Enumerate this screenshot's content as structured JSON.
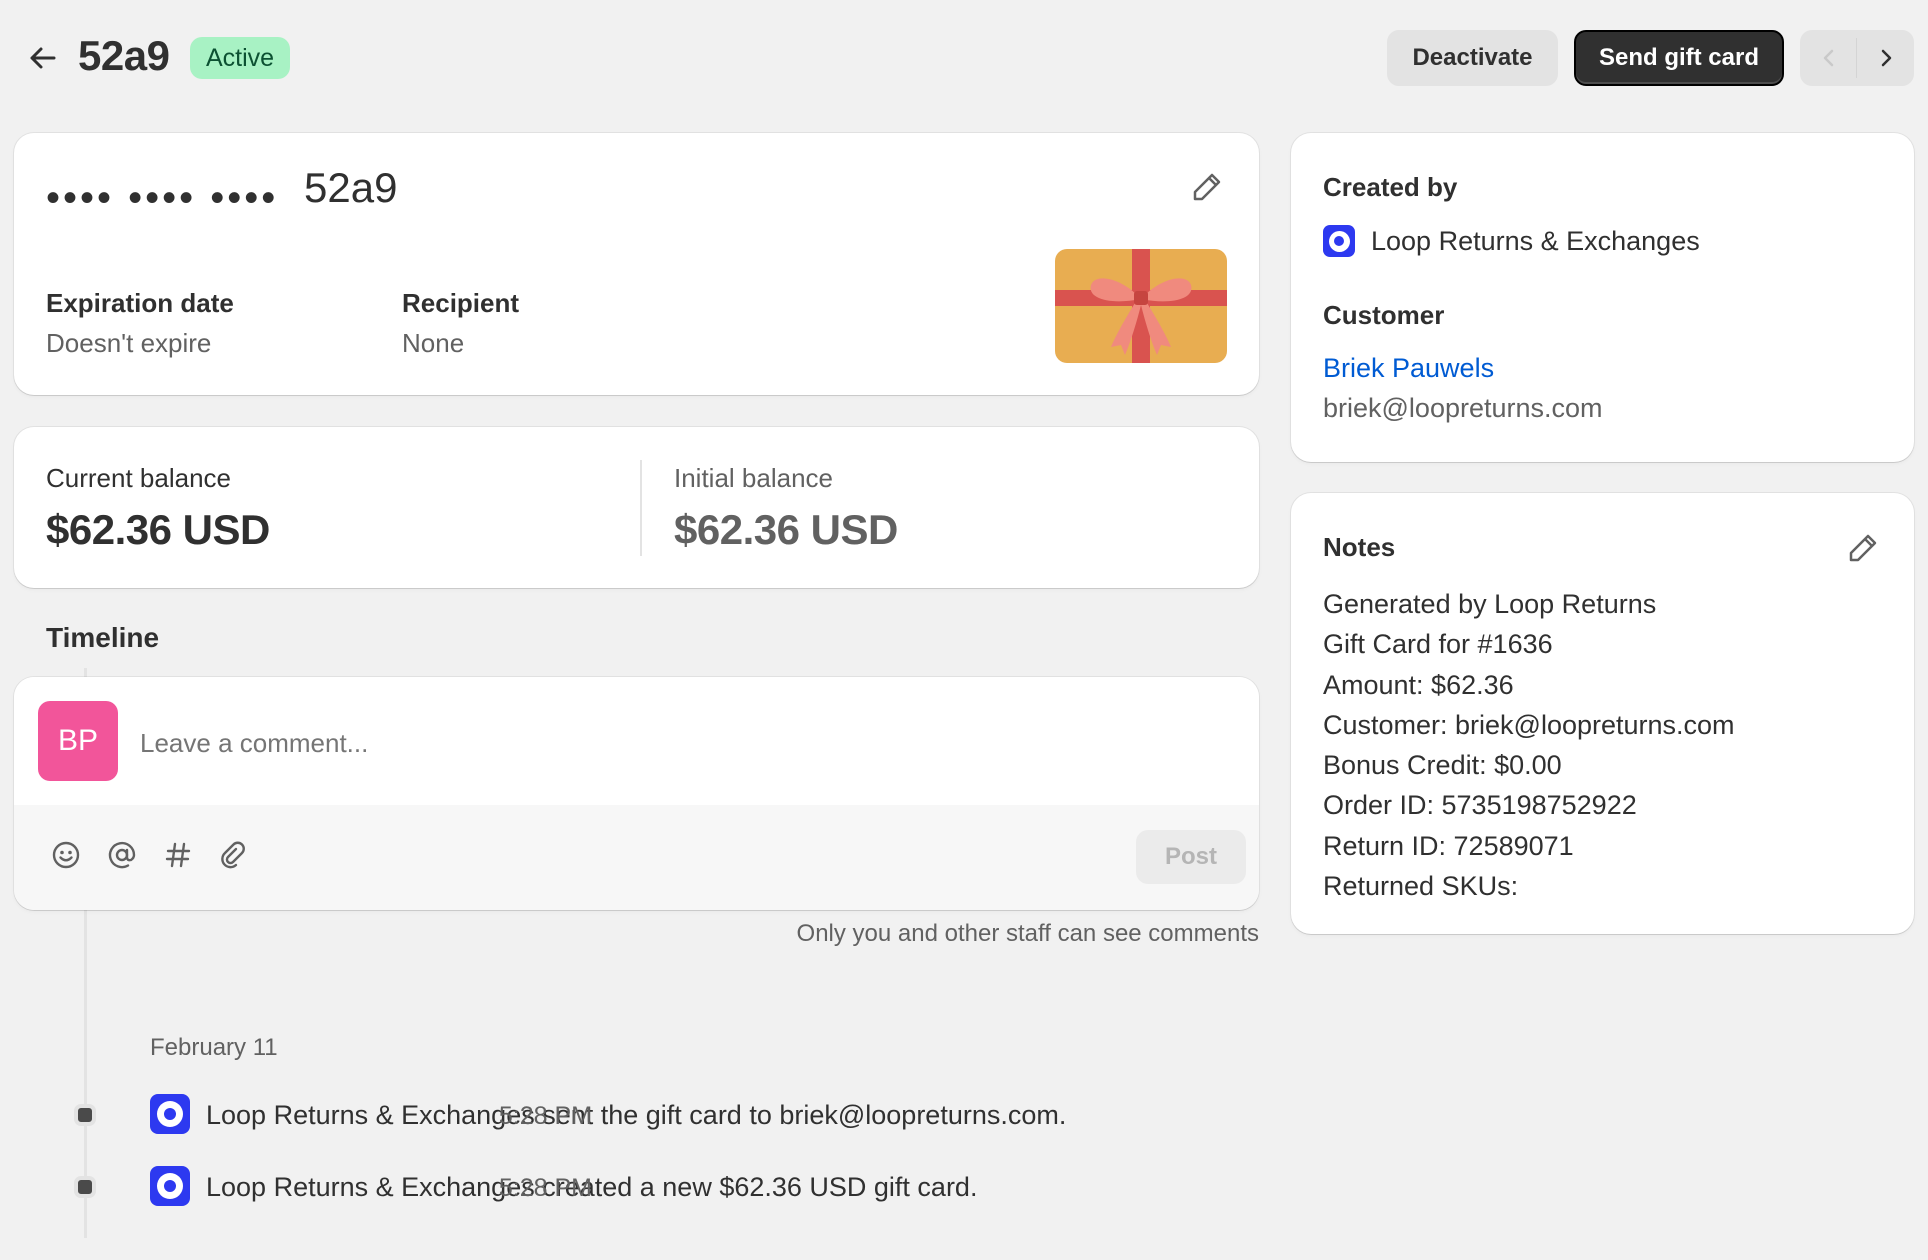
{
  "header": {
    "title": "52a9",
    "status": "Active",
    "deactivate_label": "Deactivate",
    "send_label": "Send gift card"
  },
  "gift_card": {
    "masked_code": "•••• •••• ••••",
    "last4": "52a9",
    "expiration_label": "Expiration date",
    "expiration_value": "Doesn't expire",
    "recipient_label": "Recipient",
    "recipient_value": "None"
  },
  "balance": {
    "current_label": "Current balance",
    "current_value": "$62.36 USD",
    "initial_label": "Initial balance",
    "initial_value": "$62.36 USD"
  },
  "timeline": {
    "title": "Timeline",
    "avatar_initials": "BP",
    "comment_placeholder": "Leave a comment...",
    "post_label": "Post",
    "staff_note": "Only you and other staff can see comments",
    "date_header": "February 11",
    "events": [
      {
        "text": "Loop Returns & Exchanges sent the gift card to briek@loopreturns.com.",
        "time": "5:28 PM"
      },
      {
        "text": "Loop Returns & Exchanges created a new $62.36 USD gift card.",
        "time": "5:28 PM"
      }
    ]
  },
  "sidebar": {
    "created_by_heading": "Created by",
    "creator": "Loop Returns & Exchanges",
    "customer_heading": "Customer",
    "customer_name": "Briek Pauwels",
    "customer_email": "briek@loopreturns.com",
    "notes_heading": "Notes",
    "notes": [
      "Generated by Loop Returns",
      "Gift Card for #1636",
      "Amount: $62.36",
      "Customer: briek@loopreturns.com",
      "Bonus Credit: $0.00",
      "Order ID: 5735198752922",
      "Return ID: 72589071",
      "Returned SKUs:"
    ]
  },
  "icons": {
    "back": "arrow-left-icon",
    "prev": "chevron-left-icon",
    "next": "chevron-right-icon",
    "edit": "pencil-icon",
    "emoji": "smiley-icon",
    "mention": "at-sign-icon",
    "hashtag": "hashtag-icon",
    "attach": "paperclip-icon",
    "loop": "loop-logo-icon",
    "gift": "gift-card-icon"
  },
  "colors": {
    "primary_button": "#303030",
    "active_badge_bg": "#a8f2c4",
    "active_badge_text": "#0c5132",
    "link": "#005bd3",
    "loop_brand": "#2d39f0",
    "avatar_bg": "#f2559a",
    "gift_card_bg": "#e8ad51",
    "gift_ribbon": "#d9534f"
  }
}
